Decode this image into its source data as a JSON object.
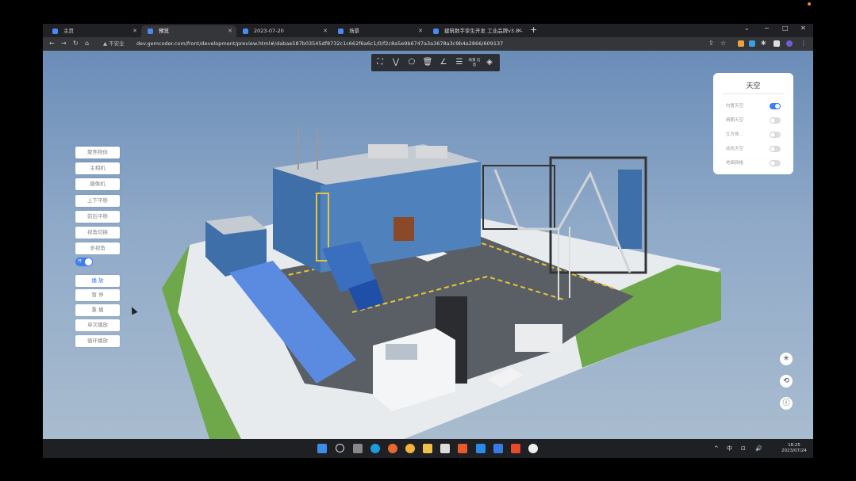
{
  "browser": {
    "tabs": [
      {
        "label": "主页",
        "color": "#4a8af4"
      },
      {
        "label": "预览",
        "color": "#4a8af4"
      },
      {
        "label": "2023-07-20",
        "color": "#4a8af4"
      },
      {
        "label": "场景",
        "color": "#4a8af4"
      },
      {
        "label": "建筑数字孪生开发 工业品牌v3.8 -",
        "color": "#4a8af4"
      }
    ],
    "new_tab": "+",
    "window_controls": {
      "minimize": "−",
      "maximize": "□",
      "close": "✕",
      "menu": "⌄"
    },
    "security_label": "▲ 不安全",
    "url": "dev.gemcoder.com/front/development/preview.html#/dabae587b03545df8732c1c662f6a6c1/0/f2c8a5e9b6747a3a3678a3c9b4a2866/609137"
  },
  "toolbar": {
    "tools": [
      {
        "icon": "fullscreen-icon",
        "glyph": "⛶"
      },
      {
        "icon": "polyline-icon",
        "glyph": "⋁"
      },
      {
        "icon": "polygon-icon",
        "glyph": "⬠"
      },
      {
        "icon": "trash-icon",
        "glyph": "🗑"
      },
      {
        "icon": "angle-icon",
        "glyph": "∠"
      },
      {
        "icon": "list-icon",
        "glyph": "☰"
      },
      {
        "icon": "label-icon",
        "label": "场景 信息"
      },
      {
        "icon": "eraser-icon",
        "glyph": "◈"
      }
    ]
  },
  "left_panel": {
    "buttons": [
      "聚焦物体",
      "主相机",
      "摄像机",
      "上下平移",
      "前后平移",
      "视角切换",
      "多视角"
    ],
    "toggle_label": "开",
    "playback_buttons": [
      "播 放",
      "暂 停",
      "重 播",
      "单次播放",
      "循环播放"
    ]
  },
  "sky_panel": {
    "title": "天空",
    "options": [
      {
        "label": "内置天空",
        "on": true
      },
      {
        "label": "晴朗天空",
        "on": false
      },
      {
        "label": "立方体...",
        "on": false
      },
      {
        "label": "动态天空",
        "on": false
      },
      {
        "label": "地面网格",
        "on": false
      }
    ]
  },
  "right_controls": [
    {
      "icon": "compass-icon",
      "glyph": "✳"
    },
    {
      "icon": "rotate-icon",
      "glyph": "⟲"
    },
    {
      "icon": "info-icon",
      "glyph": "ⓘ"
    }
  ],
  "taskbar": {
    "tray": [
      "^",
      "中",
      "⊡",
      "🔊"
    ],
    "time": "18:25",
    "date": "2023/07/24"
  },
  "colors": {
    "accent": "#3c7ff0",
    "sky_top": "#6a8db8",
    "building_blue": "#3e6fa8",
    "grass": "#6fa84a"
  }
}
